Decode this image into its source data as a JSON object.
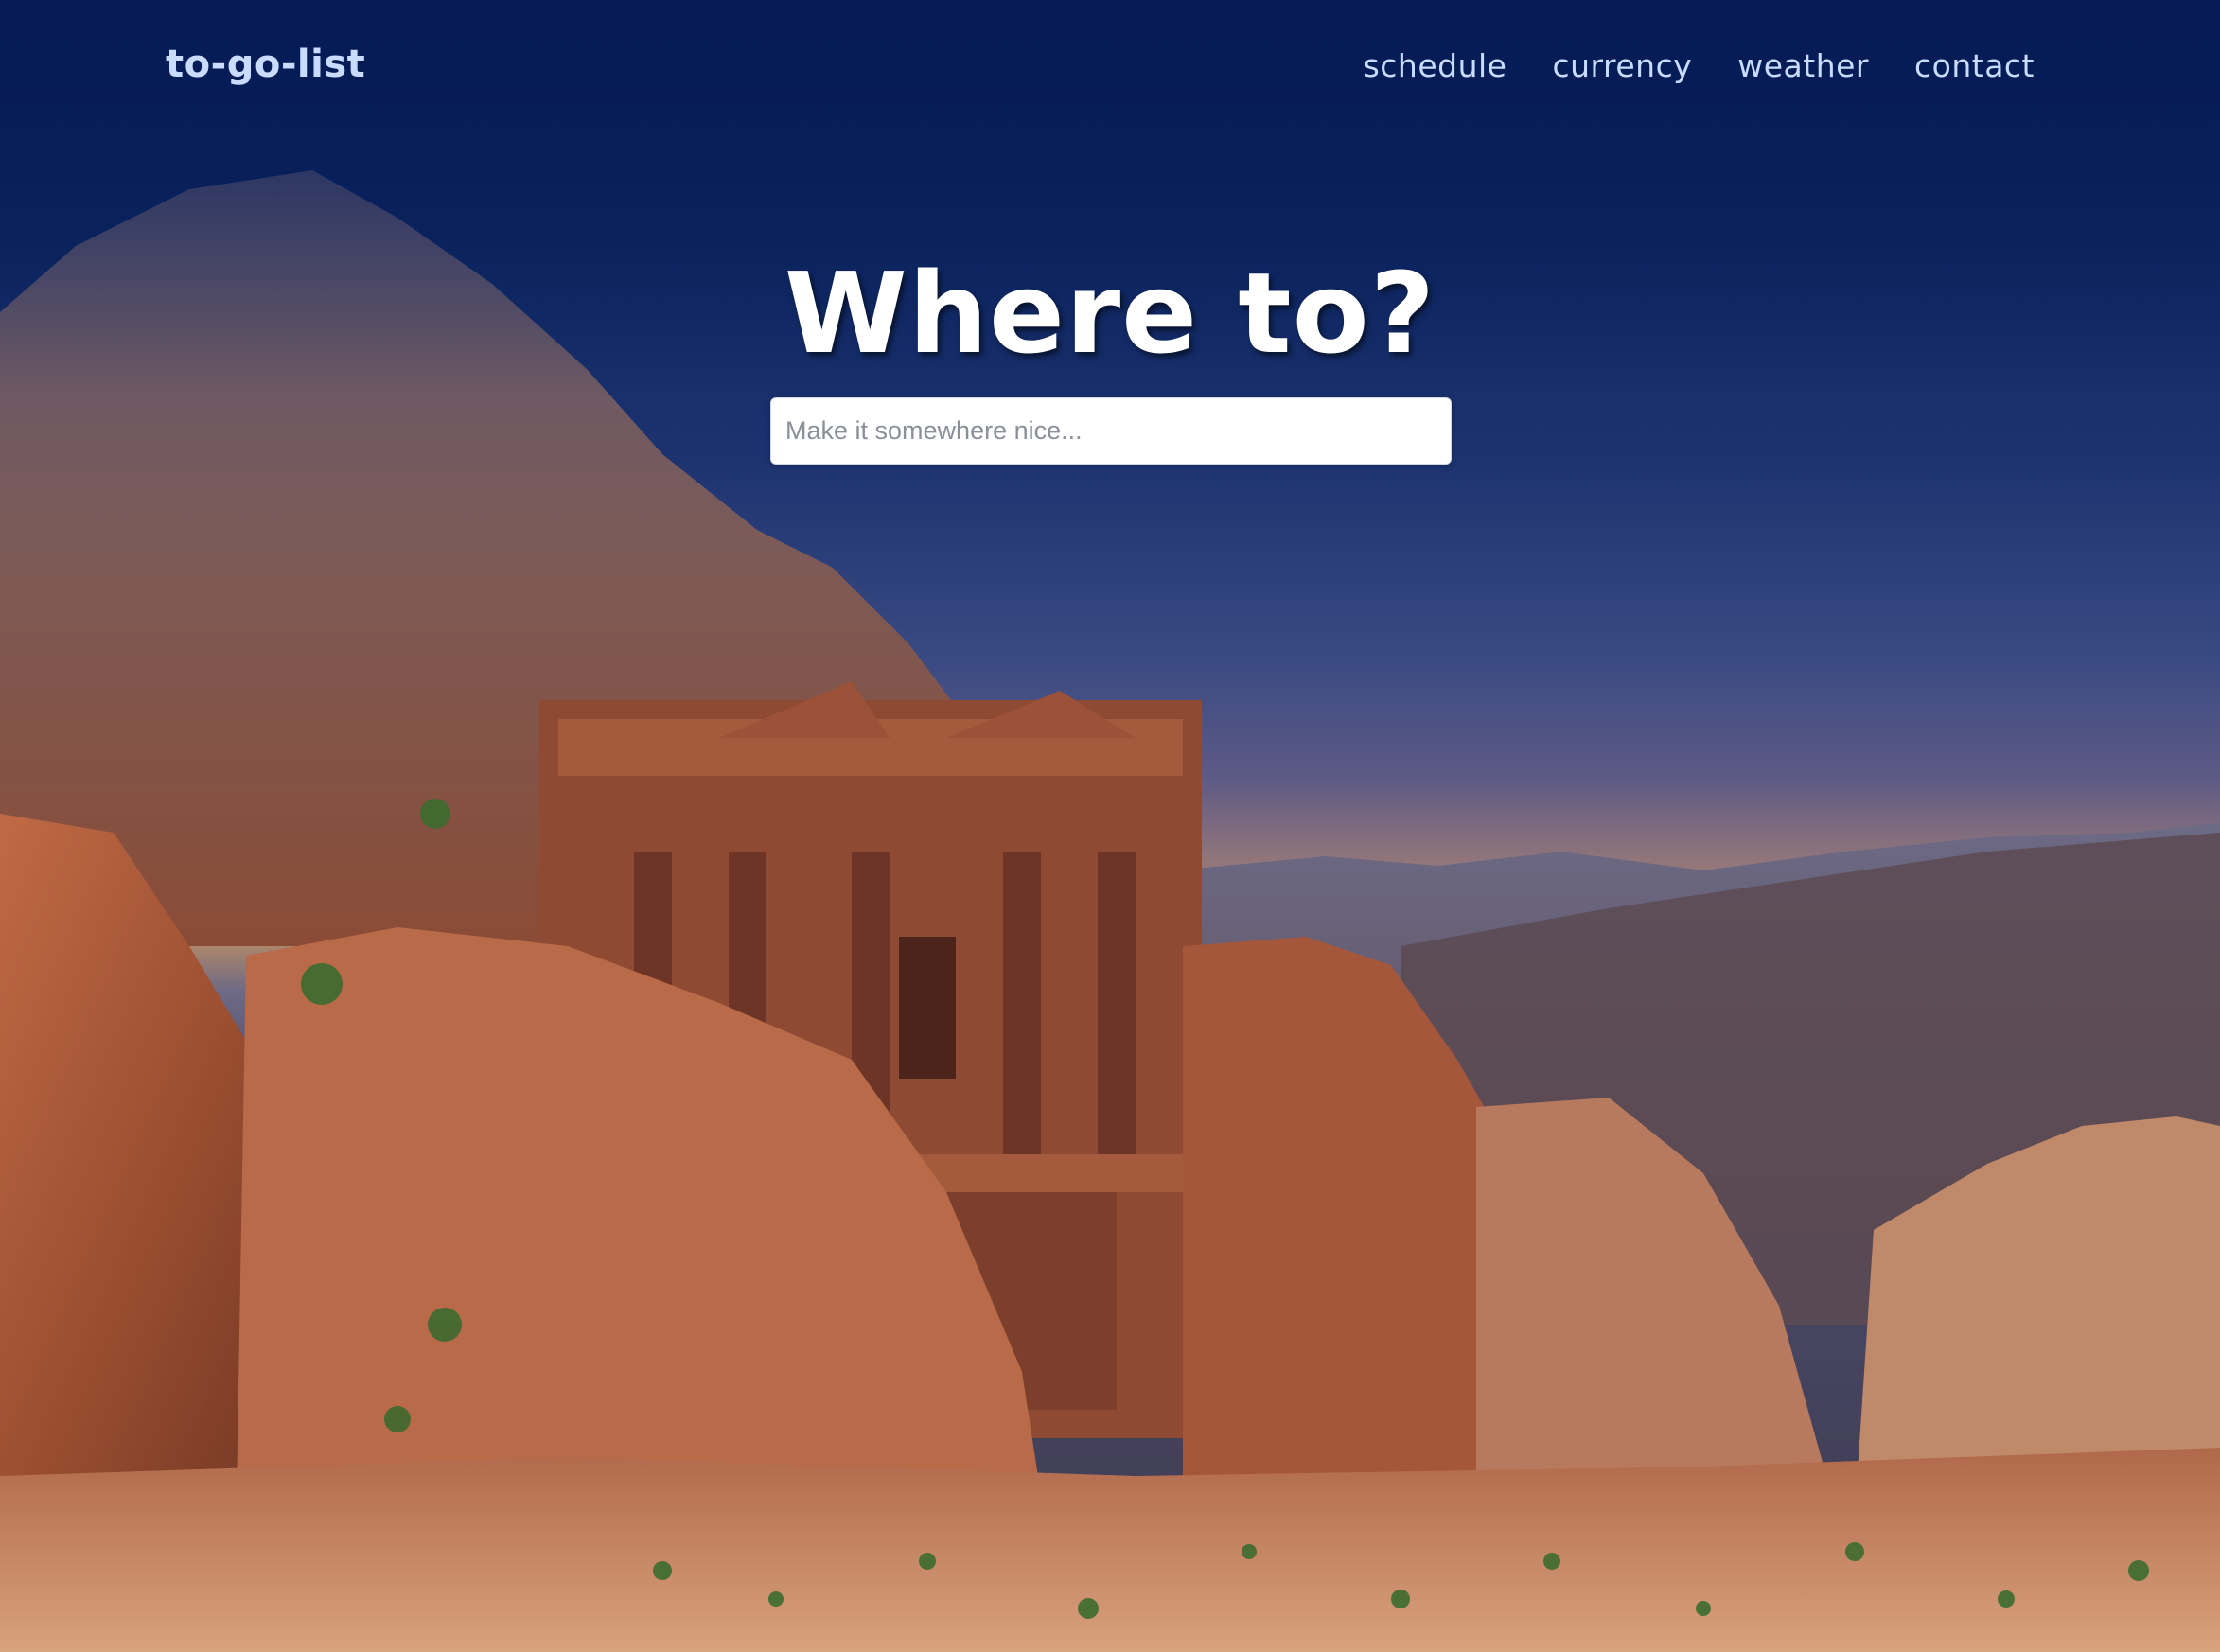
{
  "nav": {
    "brand": "to-go-list",
    "links": [
      {
        "label": "schedule"
      },
      {
        "label": "currency"
      },
      {
        "label": "weather"
      },
      {
        "label": "contact"
      }
    ]
  },
  "hero": {
    "headline": "Where to?",
    "search_placeholder": "Make it somewhere nice...",
    "search_value": "",
    "background_image": "rock-carved-temple-in-desert-canyon-at-dusk"
  },
  "colors": {
    "nav_text": "#c9dcff",
    "sky_top": "#061b55",
    "sandstone": "#9c4f31",
    "headline": "#ffffff"
  }
}
